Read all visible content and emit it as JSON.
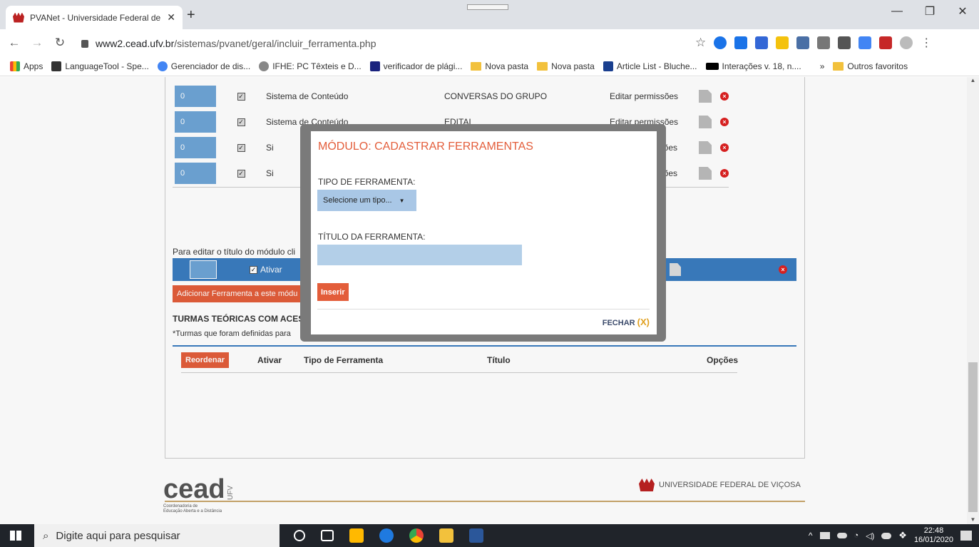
{
  "browser": {
    "tab_title": "PVANet - Universidade Federal de",
    "tab_close": "✕",
    "new_tab": "+",
    "url_domain": "www2.cead.ufv.br",
    "url_path": "/sistemas/pvanet/geral/incluir_ferramenta.php",
    "bookmarks": [
      {
        "label": "Apps",
        "color": "#f4b400"
      },
      {
        "label": "LanguageTool - Spe...",
        "color": "#333333"
      },
      {
        "label": "Gerenciador de dis...",
        "color": "#4285f4"
      },
      {
        "label": "IFHE: PC Têxteis e D...",
        "color": "#666666"
      },
      {
        "label": "verificador de plági...",
        "color": "#1a237e"
      },
      {
        "label": "Nova pasta",
        "color": "#f2c13c"
      },
      {
        "label": "Nova pasta",
        "color": "#f2c13c"
      },
      {
        "label": "Article List - Bluche...",
        "color": "#1a3f8f"
      },
      {
        "label": "Interações v. 18, n....",
        "color": "#000000"
      }
    ],
    "more_bookmarks": "»",
    "other_bookmarks": "Outros favoritos"
  },
  "table": {
    "rows": [
      {
        "num": "0",
        "type": "Sistema de Conteúdo",
        "title": "CONVERSAS DO GRUPO",
        "perm": "Editar permissões"
      },
      {
        "num": "0",
        "type": "Sistema de Conteúdo",
        "title": "EDITAL",
        "perm": "Editar permissões"
      },
      {
        "num": "0",
        "type": "Si",
        "title": "",
        "perm": "ar permissões"
      },
      {
        "num": "0",
        "type": "Si",
        "title": "",
        "perm": "ar permissões"
      }
    ]
  },
  "module": {
    "edit_hint": "Para editar o título do módulo cli",
    "activate_label": "Ativar",
    "add_tool_button": "Adicionar Ferramenta a este módu",
    "section_title": "TURMAS TEÓRICAS COM ACES",
    "note": "*Turmas que foram definidas para",
    "columns": {
      "reorder": "Reordenar",
      "activate": "Ativar",
      "tool_type": "Tipo de Ferramenta",
      "title": "Título",
      "options": "Opções"
    }
  },
  "modal": {
    "title": "MÓDULO: CADASTRAR FERRAMENTAS",
    "type_label": "TIPO DE FERRAMENTA:",
    "type_select": "Selecione um tipo...",
    "title_label": "TÍTULO DA FERRAMENTA:",
    "title_value": "",
    "insert_button": "Inserir",
    "close_label": "FECHAR",
    "close_x": "(X)"
  },
  "footer": {
    "logo_text": "cead",
    "logo_sub": "UFV",
    "logo_caption_1": "Coordenadoria de",
    "logo_caption_2": "Educação Aberta e a Distância",
    "university": "UNIVERSIDADE FEDERAL DE VIÇOSA"
  },
  "taskbar": {
    "search_placeholder": "Digite aqui para pesquisar",
    "time": "22:48",
    "date": "16/01/2020"
  }
}
